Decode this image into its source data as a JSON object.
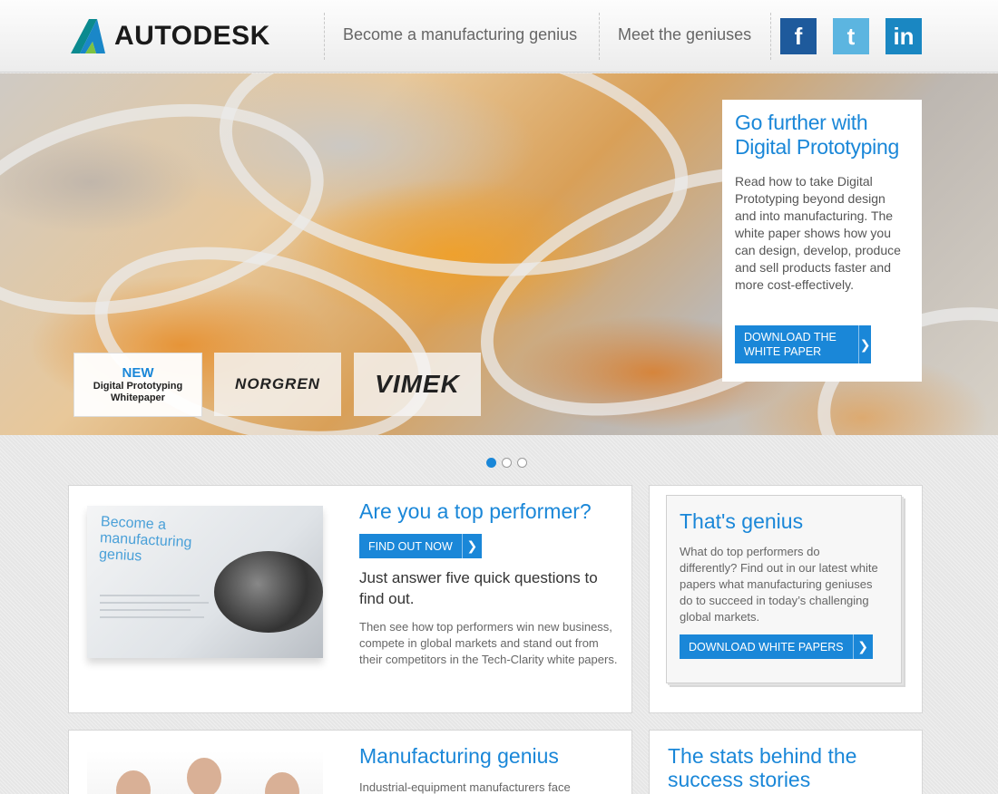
{
  "header": {
    "logo_text": "AUTODESK",
    "nav": [
      "Become a manufacturing genius",
      "Meet the geniuses"
    ],
    "social": {
      "facebook": "f",
      "twitter": "t",
      "linkedin": "in"
    },
    "colors": {
      "facebook": "#1e5a9c",
      "twitter": "#5cb5e0",
      "linkedin": "#1a87c2"
    }
  },
  "hero": {
    "thumbs": {
      "new_label": "NEW",
      "new_line1": "Digital Prototyping",
      "new_line2": "Whitepaper",
      "norgren": "NORGREN",
      "vimek": "VIMEK"
    },
    "promo": {
      "title": "Go further with Digital Prototyping",
      "body": "Read how to take Digital Prototyping beyond design and into manufacturing. The white paper shows how you can design, develop, produce and sell products faster and more cost-effectively.",
      "button": "DOWNLOAD THE WHITE PAPER"
    },
    "carousel": {
      "count": 3,
      "active_index": 0
    }
  },
  "cards": {
    "performer": {
      "thumb_title": "Become a manufacturing genius",
      "title": "Are you a top performer?",
      "button": "FIND OUT NOW",
      "lead": "Just answer five quick questions to find out.",
      "body": "Then see how top performers win new business, compete in global markets and stand out from their competitors in the Tech-Clarity white papers."
    },
    "genius": {
      "title": "That's genius",
      "body": "What do top performers do differently? Find out in our latest white papers what manufacturing geniuses do to succeed in today’s challenging global markets.",
      "button": "DOWNLOAD WHITE PAPERS"
    },
    "manufacturing": {
      "title": "Manufacturing genius",
      "body": "Industrial-equipment manufacturers face"
    },
    "stats": {
      "title": "The stats behind the success stories"
    }
  },
  "accent_color": "#1a87d8"
}
